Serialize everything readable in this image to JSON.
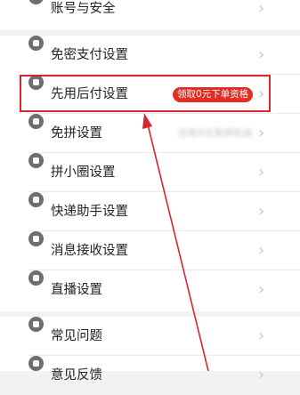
{
  "menu": {
    "account_security": "账号与安全",
    "password_free_pay": "免密支付设置",
    "pay_later": "先用后付设置",
    "pay_later_badge": "领取0元下单资格",
    "group_buy": "免拼设置",
    "group_buy_hint": "还有0次免拼机会",
    "circle": "拼小圈设置",
    "delivery": "快递助手设置",
    "messages": "消息接收设置",
    "live": "直播设置",
    "faq": "常见问题",
    "feedback": "意见反馈"
  },
  "colors": {
    "accent_red": "#e02e24",
    "highlight_border": "#d7262f"
  }
}
